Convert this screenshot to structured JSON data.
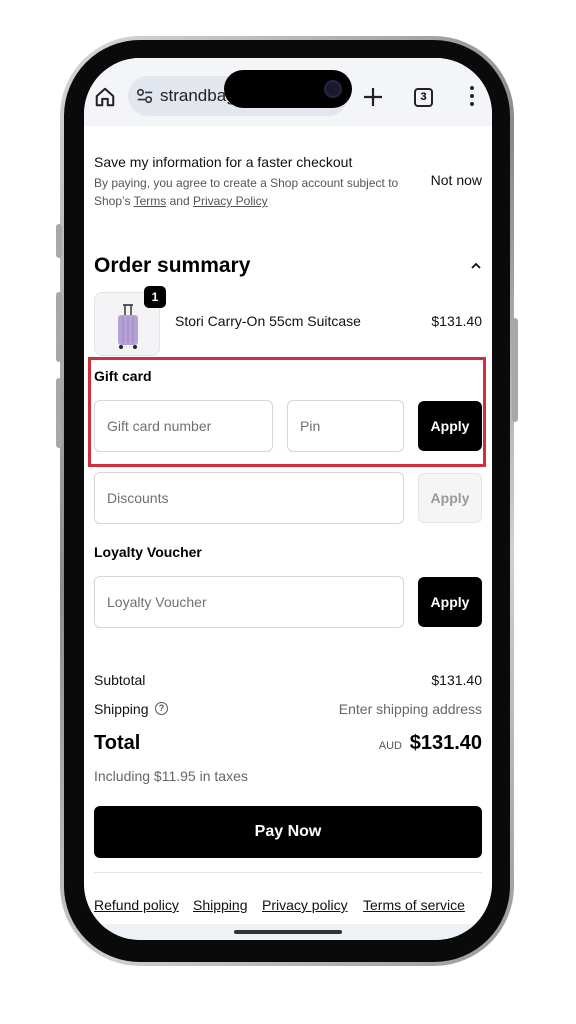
{
  "browser": {
    "url_text": "strandbags",
    "tab_count": "3",
    "icons": [
      "home-icon",
      "site-settings-icon",
      "new-tab-plus-icon",
      "tab-switcher-icon",
      "more-menu-icon"
    ]
  },
  "save_info": {
    "title": "Save my information for a faster checkout",
    "desc_prefix": "By paying, you agree to create a Shop account subject to Shop’s ",
    "terms_link": "Terms",
    "desc_and": " and ",
    "privacy_link": "Privacy Policy",
    "not_now": "Not now"
  },
  "order_summary": {
    "title": "Order summary",
    "item": {
      "name": "Stori Carry-On 55cm Suitcase",
      "price": "$131.40",
      "quantity": "1"
    }
  },
  "gift_card": {
    "label": "Gift card",
    "number_placeholder": "Gift card number",
    "pin_placeholder": "Pin",
    "apply": "Apply"
  },
  "discounts": {
    "placeholder": "Discounts",
    "apply": "Apply"
  },
  "loyalty": {
    "label": "Loyalty Voucher",
    "placeholder": "Loyalty Voucher",
    "apply": "Apply"
  },
  "totals": {
    "subtotal_label": "Subtotal",
    "subtotal_value": "$131.40",
    "shipping_label": "Shipping",
    "shipping_value": "Enter shipping address",
    "total_label": "Total",
    "currency": "AUD",
    "total_value": "$131.40",
    "taxes": "Including $11.95 in taxes"
  },
  "pay_now": "Pay Now",
  "footer_links": [
    "Refund policy",
    "Shipping",
    "Privacy policy",
    "Terms of service"
  ],
  "colors": {
    "highlight_border": "#d22d3a",
    "primary_button": "#000000"
  }
}
